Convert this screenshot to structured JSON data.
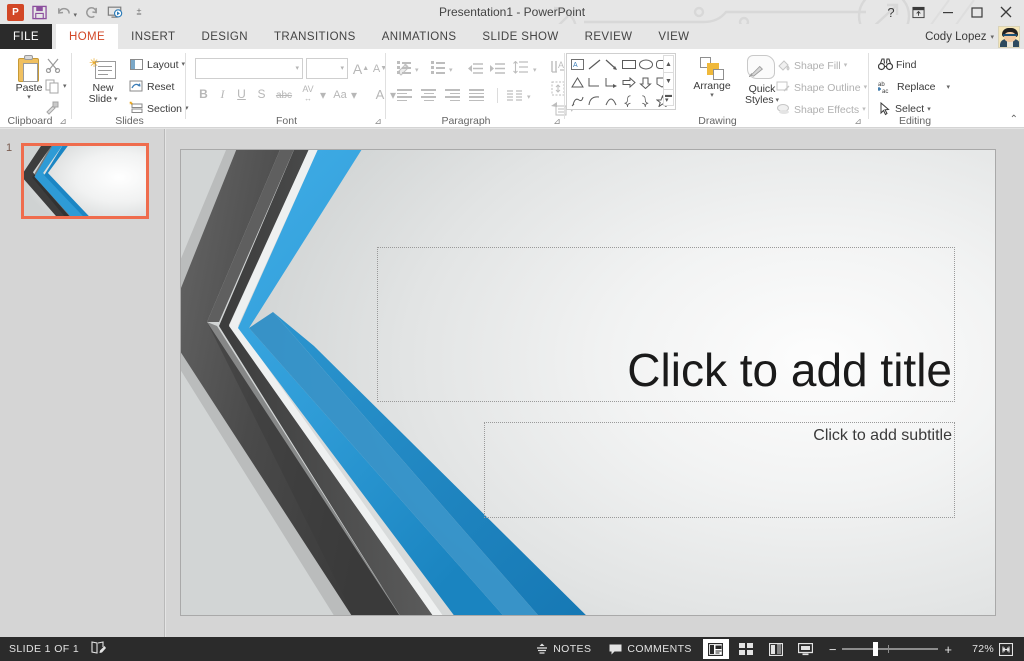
{
  "window": {
    "title": "Presentation1 - PowerPoint",
    "help_icon": "?",
    "ribbon_display_icon": "ribbon-display-options-icon",
    "minimize_icon": "–",
    "restore_icon": "□",
    "close_icon": "✕"
  },
  "quick_access": {
    "app_logo": "P",
    "items": [
      {
        "name": "save",
        "label": "Save"
      },
      {
        "name": "undo",
        "label": "Undo"
      },
      {
        "name": "redo",
        "label": "Repeat"
      },
      {
        "name": "start-from-beginning",
        "label": "Start From Beginning"
      },
      {
        "name": "customize",
        "label": "Customize Quick Access Toolbar"
      }
    ]
  },
  "tabs": {
    "file": "FILE",
    "items": [
      {
        "label": "HOME",
        "active": true
      },
      {
        "label": "INSERT",
        "active": false
      },
      {
        "label": "DESIGN",
        "active": false
      },
      {
        "label": "TRANSITIONS",
        "active": false
      },
      {
        "label": "ANIMATIONS",
        "active": false
      },
      {
        "label": "SLIDE SHOW",
        "active": false
      },
      {
        "label": "REVIEW",
        "active": false
      },
      {
        "label": "VIEW",
        "active": false
      }
    ]
  },
  "account": {
    "user_name": "Cody Lopez",
    "caret": "▾"
  },
  "ribbon": {
    "clipboard": {
      "label": "Clipboard",
      "paste": "Paste",
      "paste_caret": "▾",
      "cut": "Cut",
      "copy": "Copy",
      "format_painter": "Format Painter",
      "dialog_launcher": "⊿"
    },
    "slides": {
      "label": "Slides",
      "new_slide_line1": "New",
      "new_slide_line2": "Slide",
      "new_slide_caret": "▾",
      "layout": "Layout",
      "layout_caret": "▾",
      "reset": "Reset",
      "section": "Section",
      "section_caret": "▾"
    },
    "font": {
      "label": "Font",
      "font_name_value": "",
      "font_name_placeholder": "",
      "font_size_value": "",
      "font_size_placeholder": "",
      "increase_size": "A",
      "decrease_size": "A",
      "clear_formatting": "Clear All Formatting",
      "bold": "B",
      "italic": "I",
      "underline": "U",
      "shadow": "S",
      "strikethrough": "abc",
      "char_spacing": "AV",
      "change_case": "Aa",
      "font_color": "A",
      "caret": "▾",
      "dialog_launcher": "⊿"
    },
    "paragraph": {
      "label": "Paragraph",
      "bullets": "Bullets",
      "numbering": "Numbering",
      "decrease_indent": "Decrease List Level",
      "increase_indent": "Increase List Level",
      "line_spacing": "Line Spacing",
      "text_direction": "Text Direction",
      "align_text": "Align Text",
      "smartart": "Convert to SmartArt",
      "align_left": "Align Left",
      "center": "Center",
      "align_right": "Align Right",
      "justify": "Justify",
      "columns": "Columns",
      "caret": "▾",
      "dialog_launcher": "⊿"
    },
    "drawing": {
      "label": "Drawing",
      "shapes_row1": [
        "text-box",
        "line",
        "arrow-line",
        "rectangle",
        "oval",
        "rounded-rectangle"
      ],
      "shapes_row2": [
        "triangle",
        "elbow-connector",
        "elbow-arrow-connector",
        "right-arrow",
        "down-arrow",
        "pentagon-flag"
      ],
      "shapes_row3": [
        "freeform",
        "curve",
        "arc",
        "left-brace",
        "right-brace",
        "star"
      ],
      "scroll_up": "▲",
      "scroll_down": "▼",
      "scroll_more": "▾",
      "arrange": "Arrange",
      "arrange_caret": "▾",
      "quick_styles_line1": "Quick",
      "quick_styles_line2": "Styles",
      "quick_styles_caret": "▾",
      "shape_fill": "Shape Fill",
      "shape_outline": "Shape Outline",
      "shape_effects": "Shape Effects",
      "caret": "▾",
      "dialog_launcher": "⊿"
    },
    "editing": {
      "label": "Editing",
      "find": "Find",
      "replace": "Replace",
      "replace_caret": "▾",
      "select": "Select",
      "select_caret": "▾",
      "collapse_ribbon": "⌃"
    }
  },
  "slide_panel": {
    "slide_number": "1"
  },
  "slide": {
    "title_placeholder": "Click to add title",
    "subtitle_placeholder": "Click to add subtitle",
    "theme_accent_blue": "#2e9bd6",
    "theme_accent_dark": "#4a4a4a"
  },
  "status_bar": {
    "slide_count": "SLIDE 1 OF 1",
    "language_icon": "proofing-icon",
    "notes": "NOTES",
    "comments": "COMMENTS",
    "views": [
      {
        "name": "normal-view",
        "label": "Normal",
        "active": true
      },
      {
        "name": "slide-sorter-view",
        "label": "Slide Sorter",
        "active": false
      },
      {
        "name": "reading-view",
        "label": "Reading View",
        "active": false
      },
      {
        "name": "slide-show-view",
        "label": "Slide Show",
        "active": false
      }
    ],
    "zoom_out": "−",
    "zoom_in": "+",
    "zoom_level": "72%",
    "fit_to_window": "fit-slide-icon"
  }
}
